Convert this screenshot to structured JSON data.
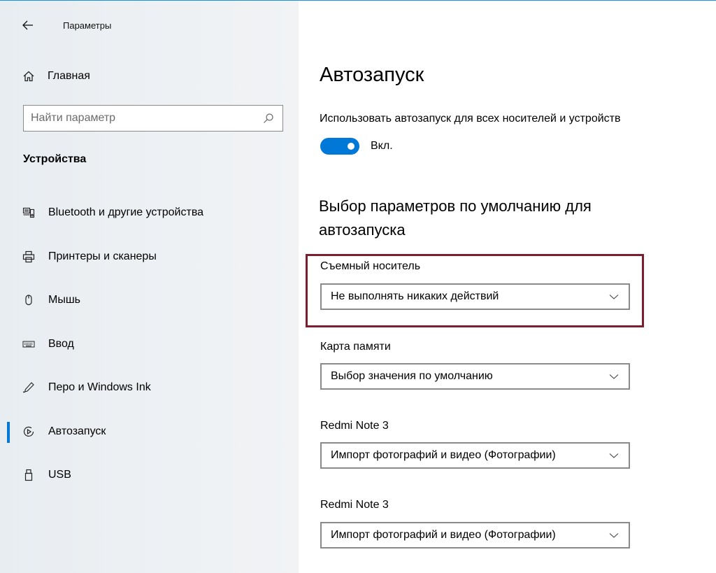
{
  "window": {
    "title": "Параметры",
    "controls": [
      "minimize",
      "maximize",
      "close"
    ]
  },
  "sidebar": {
    "home_label": "Главная",
    "search_placeholder": "Найти параметр",
    "section_heading": "Устройства",
    "items": [
      {
        "label": "Bluetooth и другие устройства",
        "icon": "bluetooth-devices-icon",
        "active": false
      },
      {
        "label": "Принтеры и сканеры",
        "icon": "printer-icon",
        "active": false
      },
      {
        "label": "Мышь",
        "icon": "mouse-icon",
        "active": false
      },
      {
        "label": "Ввод",
        "icon": "keyboard-icon",
        "active": false
      },
      {
        "label": "Перо и Windows Ink",
        "icon": "pen-icon",
        "active": false
      },
      {
        "label": "Автозапуск",
        "icon": "autoplay-icon",
        "active": true
      },
      {
        "label": "USB",
        "icon": "usb-icon",
        "active": false
      }
    ]
  },
  "main": {
    "title": "Автозапуск",
    "use_autoplay_label": "Использовать автозапуск для всех носителей и устройств",
    "toggle_state": "Вкл.",
    "toggle_on": true,
    "defaults_heading": "Выбор параметров по умолчанию для автозапуска",
    "fields": [
      {
        "label": "Съемный носитель",
        "value": "Не выполнять никаких действий",
        "highlighted": true
      },
      {
        "label": "Карта памяти",
        "value": "Выбор значения по умолчанию",
        "highlighted": false
      },
      {
        "label": "Redmi Note 3",
        "value": "Импорт фотографий и видео (Фотографии)",
        "highlighted": false
      },
      {
        "label": "Redmi Note 3",
        "value": "Импорт фотографий и видео (Фотографии)",
        "highlighted": false
      }
    ]
  },
  "colors": {
    "accent": "#0078d7",
    "highlight_border": "#7b1e2e",
    "sidebar_bg": "#eef1f4"
  }
}
